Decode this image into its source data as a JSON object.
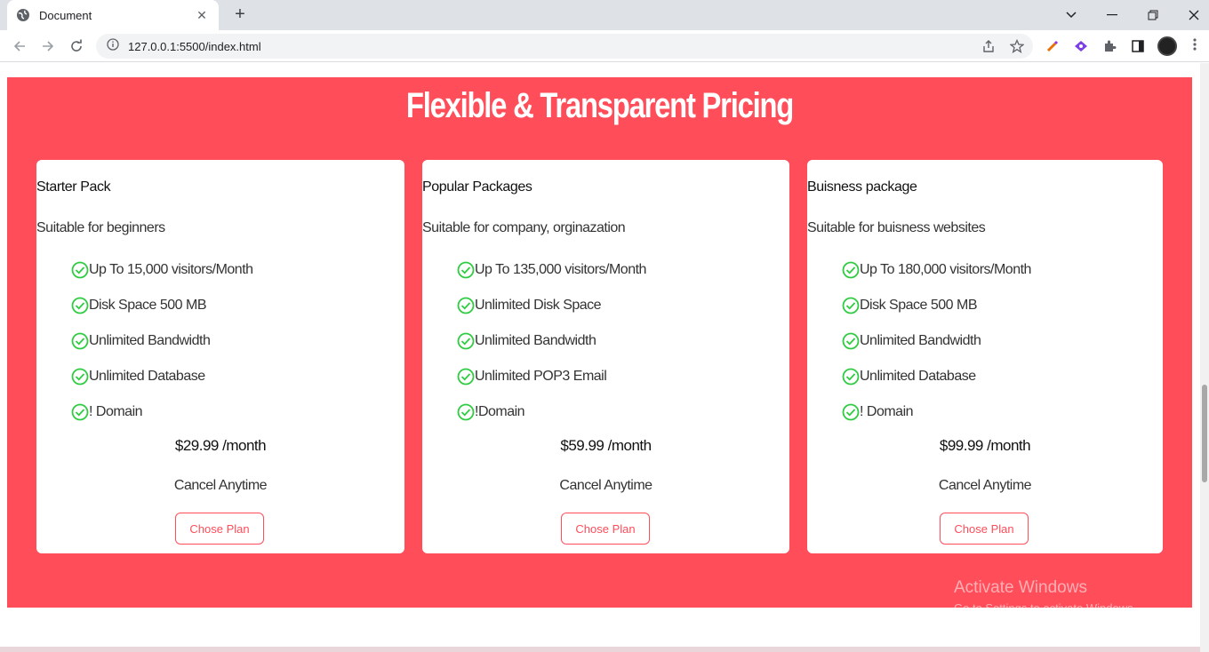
{
  "browser": {
    "tab_title": "Document",
    "tab_close": "✕",
    "new_tab": "+",
    "url": "127.0.0.1:5500/index.html"
  },
  "page": {
    "heading": "Flexible & Transparent Pricing",
    "plans": [
      {
        "name": "Starter Pack",
        "description": "Suitable for beginners",
        "features": [
          "Up To 15,000 visitors/Month",
          "Disk Space 500 MB",
          "Unlimited Bandwidth",
          "Unlimited Database",
          "! Domain"
        ],
        "price": "$29.99 /month",
        "note": "Cancel Anytime",
        "button": "Chose Plan"
      },
      {
        "name": "Popular Packages",
        "description": "Suitable for company, orginazation",
        "features": [
          "Up To 135,000 visitors/Month",
          "Unlimited Disk Space",
          "Unlimited Bandwidth",
          "Unlimited POP3 Email",
          "!Domain"
        ],
        "price": "$59.99 /month",
        "note": "Cancel Anytime",
        "button": "Chose Plan"
      },
      {
        "name": "Buisness package",
        "description": "Suitable for buisness websites",
        "features": [
          "Up To 180,000 visitors/Month",
          "Disk Space 500 MB",
          "Unlimited Bandwidth",
          "Unlimited Database",
          "! Domain"
        ],
        "price": "$99.99 /month",
        "note": "Cancel Anytime",
        "button": "Chose Plan"
      }
    ]
  },
  "watermark": {
    "line1": "Activate Windows",
    "line2": "Go to Settings to activate Windows."
  },
  "colors": {
    "accent": "#ff4d5a",
    "check": "#2ecc40"
  }
}
